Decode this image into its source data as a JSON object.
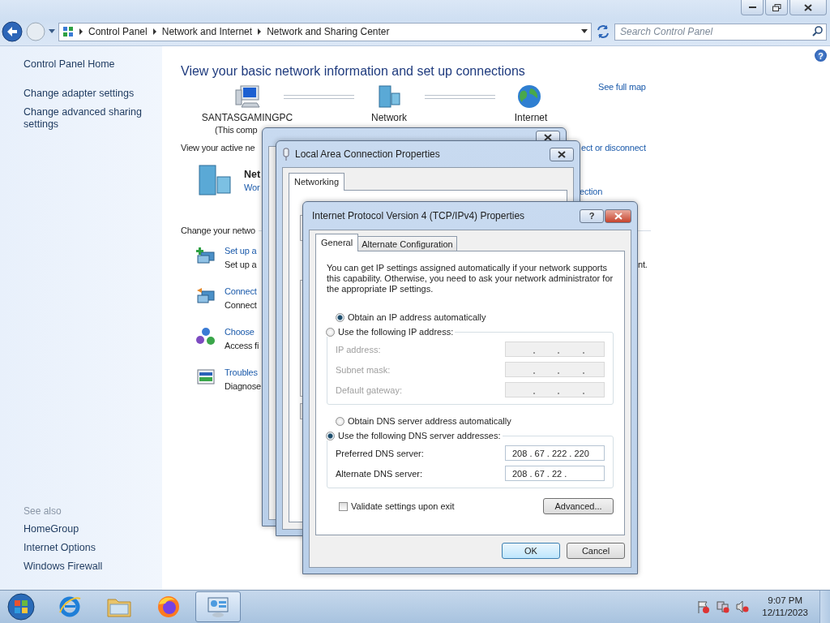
{
  "address_bar": {
    "breadcrumbs": [
      "Control Panel",
      "Network and Internet",
      "Network and Sharing Center"
    ]
  },
  "search": {
    "placeholder": "Search Control Panel"
  },
  "help": "?",
  "sidebar": {
    "items": [
      "Control Panel Home",
      "Change adapter settings",
      "Change advanced sharing settings"
    ],
    "see_also_heading": "See also",
    "see_also": [
      "HomeGroup",
      "Internet Options",
      "Windows Firewall"
    ]
  },
  "main": {
    "heading": "View your basic network information and set up connections",
    "map": {
      "nodes": [
        {
          "label": "SANTASGAMINGPC",
          "sublabel": "(This comp",
          "kind": "computer"
        },
        {
          "label": "Network",
          "kind": "network"
        },
        {
          "label": "Internet",
          "kind": "globe"
        }
      ],
      "full_map_link": "See full map"
    },
    "active_label": "View your active ne",
    "connect_link": "ect or disconnect",
    "network": {
      "name": "Net",
      "type": "Wor",
      "connection": "ection"
    },
    "change_heading": "Change your netwo",
    "tasks": [
      {
        "title": "Set up a",
        "description": "Set up a",
        "kind": "setup",
        "fragment": "nt."
      },
      {
        "title": "Connect",
        "description": "Connect",
        "kind": "connect"
      },
      {
        "title": "Choose",
        "description": "Access fi",
        "kind": "homegroup"
      },
      {
        "title": "Troubles",
        "description": "Diagnose",
        "kind": "troubleshoot"
      }
    ]
  },
  "properties_dialog": {
    "title": "Local Area Connection Properties",
    "tabs": [
      {
        "label": "Networking",
        "selected": true
      }
    ]
  },
  "ipv4_dialog": {
    "title": "Internet Protocol Version 4 (TCP/IPv4) Properties",
    "help": "?",
    "tabs": [
      {
        "label": "General",
        "selected": true
      },
      {
        "label": "Alternate Configuration",
        "selected": false
      }
    ],
    "intro": "You can get IP settings assigned automatically if your network supports this capability. Otherwise, you need to ask your network administrator for the appropriate IP settings.",
    "ip_options": [
      {
        "label": "Obtain an IP address automatically",
        "selected": true
      },
      {
        "label": "Use the following IP address:",
        "selected": false
      }
    ],
    "ip_fields": [
      {
        "label": "IP address:",
        "disabled": true
      },
      {
        "label": "Subnet mask:",
        "disabled": true
      },
      {
        "label": "Default gateway:",
        "disabled": true
      }
    ],
    "dns_options": [
      {
        "label": "Obtain DNS server address automatically",
        "selected": false
      },
      {
        "label": "Use the following DNS server addresses:",
        "selected": true
      }
    ],
    "dns_fields": [
      {
        "label": "Preferred DNS server:",
        "value": "208 . 67 . 222 . 220",
        "disabled": false
      },
      {
        "label": "Alternate DNS server:",
        "value": "208 . 67 . 22 .",
        "disabled": false
      }
    ],
    "validate": {
      "label": "Validate settings upon exit",
      "checked": false
    },
    "buttons": {
      "advanced": "Advanced...",
      "ok": "OK",
      "cancel": "Cancel"
    }
  },
  "taskbar": {
    "apps": [
      {
        "kind": "ie",
        "selected": false
      },
      {
        "kind": "explorer",
        "selected": false
      },
      {
        "kind": "firefox",
        "selected": false
      },
      {
        "kind": "control-panel",
        "selected": true
      }
    ],
    "clock": {
      "time": "9:07 PM",
      "date": "12/11/2023"
    }
  }
}
